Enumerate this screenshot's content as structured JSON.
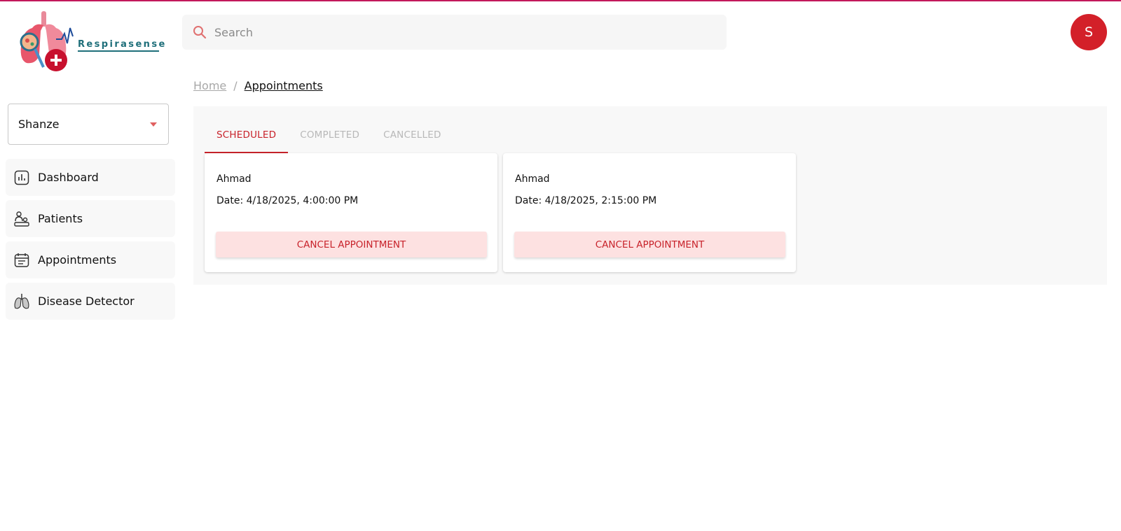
{
  "app": {
    "logo_text": "Respirasense"
  },
  "search": {
    "placeholder": "Search",
    "value": ""
  },
  "avatar": {
    "initial": "S",
    "color": "#d32029"
  },
  "sidebar": {
    "selected_doctor": "Shanze",
    "items": [
      {
        "label": "Dashboard",
        "icon": "bar-chart-icon"
      },
      {
        "label": "Patients",
        "icon": "patients-icon"
      },
      {
        "label": "Appointments",
        "icon": "calendar-icon"
      },
      {
        "label": "Disease Detector",
        "icon": "lungs-icon"
      }
    ]
  },
  "breadcrumb": {
    "home": "Home",
    "separator": "/",
    "current": "Appointments"
  },
  "tabs": [
    {
      "label": "SCHEDULED",
      "active": true
    },
    {
      "label": "COMPLETED",
      "active": false
    },
    {
      "label": "CANCELLED",
      "active": false
    }
  ],
  "appointments": [
    {
      "patient": "Ahmad",
      "date": "Date: 4/18/2025, 4:00:00 PM",
      "action": "CANCEL APPOINTMENT"
    },
    {
      "patient": "Ahmad",
      "date": "Date: 4/18/2025, 2:15:00 PM",
      "action": "CANCEL APPOINTMENT"
    }
  ],
  "colors": {
    "accent": "#c8232b",
    "brand_teal": "#1f6f7a",
    "top_border": "#c2185b"
  }
}
